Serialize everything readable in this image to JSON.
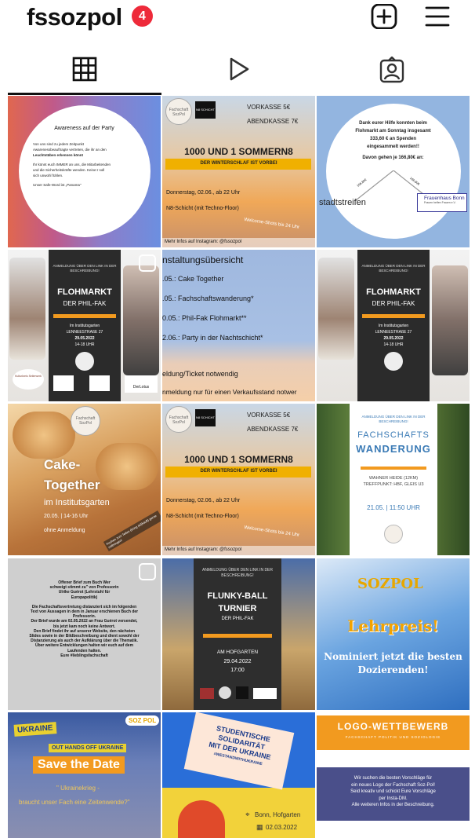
{
  "header": {
    "username": "fssozpol",
    "notification_count": "4",
    "icons": [
      "plus-square-icon",
      "hamburger-menu-icon"
    ]
  },
  "tabs": [
    {
      "name": "grid",
      "icon": "grid-icon",
      "active": true
    },
    {
      "name": "reels",
      "icon": "play-icon",
      "active": false
    },
    {
      "name": "tagged",
      "icon": "tagged-person-icon",
      "active": false
    }
  ],
  "posts": {
    "p1": {
      "title": "Awareness auf der Party",
      "line1": "Von uns sind zu jedem Zeitpunkt",
      "line2": "Awarenessbeauftragte vertreten, die ihr an den",
      "line3": "Leuchtstäben erkennen könnt",
      "line4": "Ihr könnt euch IMMER an uns, die Mitarbeitenden",
      "line5": "und die Sicherheitskräfte wenden. Keine:r soll",
      "line6": "sich unwohl fühlen.",
      "line7": "Unser Safe-Word ist „Panama\""
    },
    "p2": {
      "logo": "Fachschaft SozPol",
      "badge": "N8 SCHICHT",
      "vorkasse": "VORKASSE 5€",
      "abendkasse": "ABENDKASSE 7€",
      "title": "1000 UND 1 SOMMERN8",
      "subtitle": "DER WINTERSCHLAF IST VORBEI",
      "date": "Donnerstag, 02.06., ab 22 Uhr",
      "place": "N8-Schicht (mit Techno-Floor)",
      "welcome": "Welcome-Shots bis 24 Uhr",
      "footer": "Mehr Infos auf Instagram: @fssozpol"
    },
    "p3": {
      "line1": "Dank eurer Hilfe konnten beim",
      "line2": "Flohmarkt am Sonntag insgesamt",
      "line3": "333,60 € an Spenden",
      "line4": "eingesammelt werden!!",
      "line5": "Davon gehen je 166,80€ an:",
      "left_amount": "166,80€",
      "right_amount": "166,80€",
      "org1": "stadtstreifen",
      "org2": "Frauenhaus Bonn",
      "org2_sub": "Frauen helfen Frauen e.V."
    },
    "p4": {
      "top": "ANMELDUNG ÜBER DEN LINK IN DER BESCHREIBUNG!",
      "title": "FLOHMARKT",
      "subtitle": "DER PHIL-FAK",
      "place": "Im Institutsgarten",
      "street": "LENNEESTRAßE 27",
      "date": "29.05.2022",
      "time": "14-18 UHR",
      "sponsor": "DerLotus",
      "sponsor2": "Kulturkreis Seilerwerk"
    },
    "p5": {
      "title": "nstaltungsübersicht",
      "item1": ".05.: Cake Together",
      "item2": ".05.: Fachschaftswanderung*",
      "item3": "0.05.: Phil-Fak Flohmarkt**",
      "item4": "2.06.: Party in der Nachtschicht*",
      "note1": "eldung/Ticket notwendig",
      "note2": "nmeldung nur für einen Verkaufsstand notwer"
    },
    "p6": {
      "top": "ANMELDUNG ÜBER DEN LINK IN DER BESCHREIBUNG!",
      "title": "FLOHMARKT",
      "subtitle": "DER PHIL-FAK",
      "place": "Im Institutsgarten",
      "street": "LENNEESTRAßE 27",
      "date": "29.05.2022",
      "time": "14-18 UHR"
    },
    "p7": {
      "logo": "Fachschaft SozPol",
      "line1": "Cake-",
      "line2": "Together",
      "line3": "im Institutsgarten",
      "date": "20.05. | 14-16 Uhr",
      "note": "ohne Anmeldung",
      "corner": "Kuchen zum Teilen (bring (ei)kauft) gerne mitbringen!"
    },
    "p8": {
      "logo": "Fachschaft SozPol",
      "badge": "N8 SCHICHT",
      "vorkasse": "VORKASSE 5€",
      "abendkasse": "ABENDKASSE 7€",
      "title": "1000 UND 1 SOMMERN8",
      "subtitle": "DER WINTERSCHLAF IST VORBEI",
      "date": "Donnerstag, 02.06., ab 22 Uhr",
      "place": "N8-Schicht (mit Techno-Floor)",
      "welcome": "Welcome-Shots bis 24 Uhr",
      "footer": "Mehr Infos auf Instagram: @fssozpol"
    },
    "p9": {
      "top": "ANMELDUNG ÜBER DEN LINK IN DER BESCHREIBUNG!",
      "title1": "FACHSCHAFTS",
      "title2": "WANDERUNG",
      "line1": "WAHNER HEIDE (12KM)",
      "line2": "TREFFPUNKT: HBF, GLEIS U3",
      "date": "21.05. | 11:50 UHR"
    },
    "p10": {
      "line1": "Offener Brief zum Buch Wer",
      "line2": "schweigt stimmt zu\" von Professorin",
      "line3": "Ulrike Guérot (Lehrstuhl für",
      "line4": "Europapolitik)",
      "line5": "Die Fachschaftsvertretung distanziert sich im folgenden",
      "line6": "Text von Aussagen in dem in Januar erschienen Buch der",
      "line7": "Professorin.",
      "line8": "Der Brief wurde am 02.05.2022 an Frau Guérot versendet,",
      "line9": "bis jetzt kam noch keine Antwort.",
      "line10": "Den Brief findet ihr auf unserer Website, den nächsten",
      "line11": "Slides sowie in der Bildbeschreibung und dient sowohl der",
      "line12": "Distanzierung als auch der Aufklärung über die Thematik.",
      "line13": "Über weitere Entwicklungen halten wir euch auf dem",
      "line14": "Laufenden halten.",
      "line15": "Eure #lieblingsfachschaft"
    },
    "p11": {
      "top": "ANMELDUNG ÜBER DEN LINK IN DER BESCHREIBUNG!",
      "title1": "FLUNKY-BALL",
      "title2": "TURNIER",
      "subtitle": "DER PHIL-FAK",
      "place": "AM HOFGARTEN",
      "date": "29.04.2022",
      "time": "17:00"
    },
    "p12": {
      "logo": "SOZPOL",
      "title": "Lehrpreis!",
      "line1": "Nominiert jetzt die besten",
      "line2": "Dozierenden!"
    },
    "p13": {
      "logo": "SOZ POL",
      "sign1": "UKRAINE",
      "sign2": "OUT HANDS OFF UKRAINE",
      "title": "Save the Date",
      "sub1": "\" Ukrainekrieg -",
      "sub2": "braucht unser Fach eine Zeitenwende?\""
    },
    "p14": {
      "line1": "STUDENTISCHE",
      "line2": "SOLIDARITÄT",
      "line3": "MIT DER UKRAINE",
      "hashtag": "#WESTANDWITHUKRAINE",
      "place": "Bonn, Hofgarten",
      "date": "02.03.2022"
    },
    "p15": {
      "title": "LOGO-WETTBEWERB",
      "subtitle": "FACHSCHAFT POLITIK UND SOZIOLOGIE",
      "line1": "Wir suchen die besten Vorschläge für",
      "line2": "ein neues Logo der Fachschaft Soz-Pol!",
      "line3": "Seid kreativ und schickt Eure Vorschläge",
      "line4": "per Insta-DM.",
      "line5": "Alle weiteren Infos in der Beschreibung."
    }
  },
  "colors": {
    "accent_red": "#ee2a3a",
    "orange": "#f29a1f",
    "sky_blue": "#93b5e0"
  }
}
